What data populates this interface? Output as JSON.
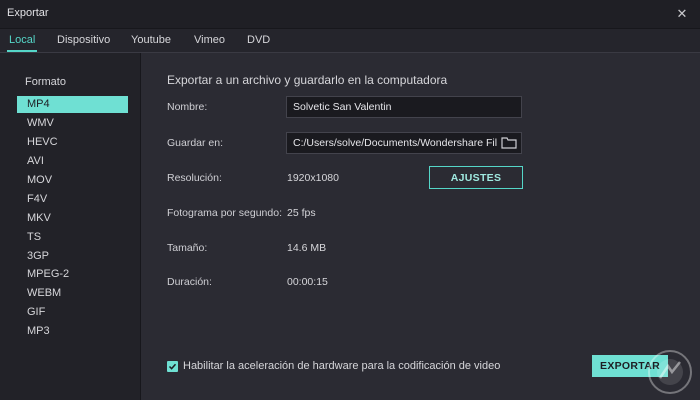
{
  "window": {
    "title": "Exportar"
  },
  "tabs": [
    "Local",
    "Dispositivo",
    "Youtube",
    "Vimeo",
    "DVD"
  ],
  "sidebar": {
    "heading": "Formato",
    "formats": [
      "MP4",
      "WMV",
      "HEVC",
      "AVI",
      "MOV",
      "F4V",
      "MKV",
      "TS",
      "3GP",
      "MPEG-2",
      "WEBM",
      "GIF",
      "MP3"
    ],
    "selected": "MP4"
  },
  "main": {
    "heading": "Exportar a un archivo y guardarlo en la computadora",
    "name_label": "Nombre:",
    "name_value": "Solvetic San Valentin",
    "save_label": "Guardar en:",
    "save_path": "C:/Users/solve/Documents/Wondershare Fil",
    "resolution_label": "Resolución:",
    "resolution_value": "1920x1080",
    "settings_button": "AJUSTES",
    "framerate_label": "Fotograma por segundo:",
    "framerate_value": "25 fps",
    "size_label": "Tamaño:",
    "size_value": "14.6 MB",
    "duration_label": "Duración:",
    "duration_value": "00:00:15",
    "hw_accel_label": "Habilitar la aceleración de hardware para la codificación de video",
    "hw_accel_checked": true,
    "export_button": "EXPORTAR"
  },
  "colors": {
    "accent": "#6fe0d3",
    "background": "#2b2b33",
    "sidebar": "#222228",
    "titlebar": "#1f1f25"
  },
  "icons": {
    "close": "close-icon",
    "folder": "folder-icon",
    "check": "checkmark-icon"
  }
}
